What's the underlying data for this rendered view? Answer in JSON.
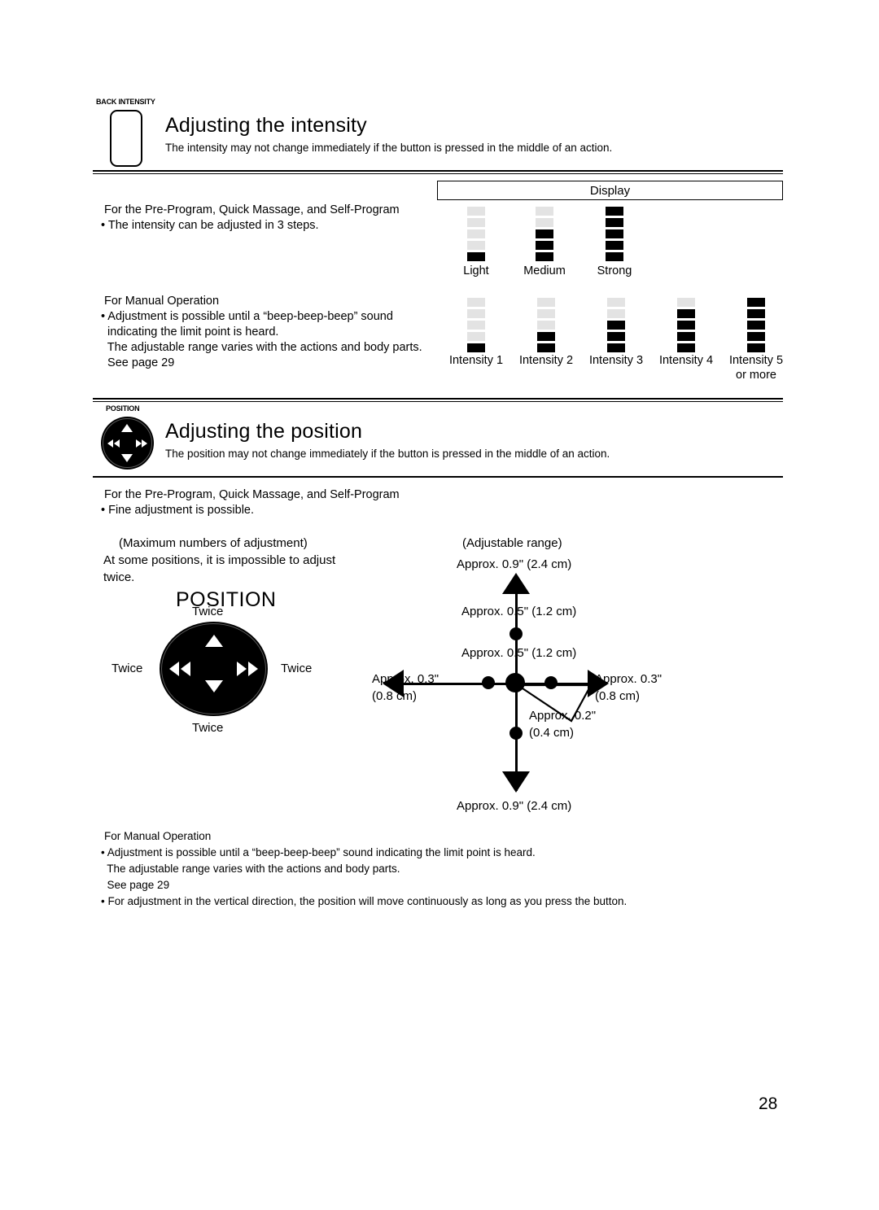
{
  "page": {
    "number": "28"
  },
  "section_intensity": {
    "badge": "BACK INTENSITY",
    "title": "Adjusting the intensity",
    "subtitle": "The intensity may not change immediately if the button is pressed in the middle of an action.",
    "preprogram_heading": "For the Pre-Program, Quick Massage, and Self-Program",
    "preprogram_bullet": "• The intensity can be adjusted in 3 steps.",
    "manual_heading": "For Manual Operation",
    "manual_lines": [
      "• Adjustment is possible until a “beep-beep-beep” sound",
      "  indicating the limit point is heard.",
      "  The adjustable range varies with the actions and body parts.",
      "  See page 29"
    ],
    "display_header": "Display",
    "preset_meters": [
      {
        "label": "Light",
        "total": 5,
        "filled": 1
      },
      {
        "label": "Medium",
        "total": 5,
        "filled": 3
      },
      {
        "label": "Strong",
        "total": 5,
        "filled": 5
      }
    ],
    "manual_meters": [
      {
        "label": "Intensity 1",
        "label2": "",
        "total": 5,
        "filled": 1
      },
      {
        "label": "Intensity 2",
        "label2": "",
        "total": 5,
        "filled": 2
      },
      {
        "label": "Intensity 3",
        "label2": "",
        "total": 5,
        "filled": 3
      },
      {
        "label": "Intensity 4",
        "label2": "",
        "total": 5,
        "filled": 4
      },
      {
        "label": "Intensity 5",
        "label2": "or more",
        "total": 5,
        "filled": 5
      }
    ]
  },
  "section_position": {
    "badge": "POSITION",
    "title": "Adjusting the position",
    "subtitle": "The position may not change immediately if the button is pressed in the middle of an action.",
    "preprogram_heading": "For the Pre-Program, Quick Massage, and Self-Program",
    "preprogram_bullet": "• Fine adjustment is possible.",
    "max_numbers_caption": "(Maximum numbers of adjustment)",
    "max_numbers_note": "At some positions, it is impossible to adjust\ntwice.",
    "dial_title": "POSITION",
    "dial_labels": {
      "top": "Twice",
      "left": "Twice",
      "right": "Twice",
      "bottom": "Twice"
    },
    "range_caption": "(Adjustable range)",
    "range_labels": {
      "top_outer": "Approx. 0.9\" (2.4 cm)",
      "top_mid": "Approx. 0.5\" (1.2 cm)",
      "top_inner": "Approx. 0.5\" (1.2 cm)",
      "left": "Approx. 0.3\"\n(0.8 cm)",
      "right": "Approx. 0.3\"\n(0.8 cm)",
      "center_small": "Approx. 0.2\"\n(0.4 cm)",
      "bottom_outer": "Approx. 0.9\" (2.4 cm)"
    },
    "manual_heading": "For Manual Operation",
    "manual_lines": [
      "• Adjustment is possible until a “beep-beep-beep” sound indicating the limit point is heard.",
      "  The adjustable range varies with the actions and body parts.",
      "  See page 29",
      "• For adjustment in the vertical direction, the position will move continuously as long as you press the button."
    ]
  }
}
